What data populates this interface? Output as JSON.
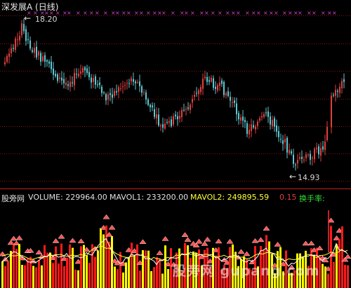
{
  "price_panel": {
    "title": "深发展A (日线)",
    "high_label": "18.20",
    "low_label": "14.93",
    "arrow_glyph": "←"
  },
  "volume_panel": {
    "site": "股旁网",
    "volume_label": "VOLUME: 229964.00",
    "mavol1_label": "MAVOL1: 233200.00",
    "mavol2_label": "MAVOL2: 249895.59",
    "value": "0.15",
    "turnover_label": "换手率:",
    "watermark": "股旁网 gupang.com"
  },
  "colors": {
    "up": "#e04040",
    "down": "#5fc8d0",
    "grid": "#8a1010",
    "marker": "#d040d0",
    "vol_red": "#ff1a1a",
    "vol_yellow": "#ffff00",
    "mavol1": "#ffffff",
    "mavol2": "#ffff33",
    "turnover": "#33dd33",
    "signal": "#ff5555"
  },
  "chart_data": {
    "type": "candlestick",
    "price_range": [
      14.8,
      18.35
    ],
    "high": 18.2,
    "low": 14.93
  }
}
